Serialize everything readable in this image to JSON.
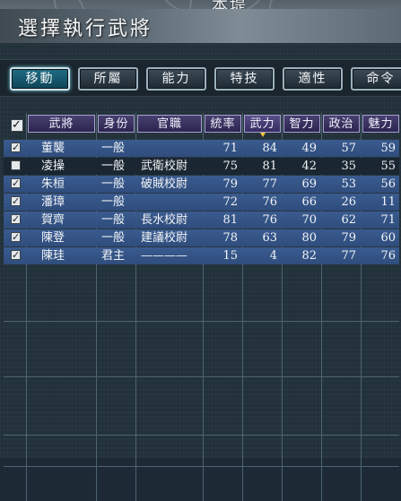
{
  "map": {
    "label": "本堤"
  },
  "title": "選擇執行武將",
  "tabs": [
    {
      "label": "移動",
      "active": true
    },
    {
      "label": "所屬",
      "active": false
    },
    {
      "label": "能力",
      "active": false
    },
    {
      "label": "特技",
      "active": false
    },
    {
      "label": "適性",
      "active": false
    },
    {
      "label": "命令",
      "active": false
    }
  ],
  "table": {
    "header_check": "✓",
    "columns": [
      "武將",
      "身份",
      "官職",
      "統率",
      "武力",
      "智力",
      "政治",
      "魅力"
    ],
    "sorted_column": "武力",
    "rows": [
      {
        "checked": true,
        "name": "董襲",
        "status": "一般",
        "office": "",
        "lead": "71",
        "war": "84",
        "int": "49",
        "pol": "57",
        "cha": "59"
      },
      {
        "checked": false,
        "name": "凌操",
        "status": "一般",
        "office": "武衛校尉",
        "lead": "75",
        "war": "81",
        "int": "42",
        "pol": "35",
        "cha": "55"
      },
      {
        "checked": true,
        "name": "朱桓",
        "status": "一般",
        "office": "破賊校尉",
        "lead": "79",
        "war": "77",
        "int": "69",
        "pol": "53",
        "cha": "56"
      },
      {
        "checked": true,
        "name": "潘璋",
        "status": "一般",
        "office": "",
        "lead": "72",
        "war": "76",
        "int": "66",
        "pol": "26",
        "cha": "11"
      },
      {
        "checked": true,
        "name": "賀齊",
        "status": "一般",
        "office": "長水校尉",
        "lead": "81",
        "war": "76",
        "int": "70",
        "pol": "62",
        "cha": "71"
      },
      {
        "checked": true,
        "name": "陳登",
        "status": "一般",
        "office": "建議校尉",
        "lead": "78",
        "war": "63",
        "int": "80",
        "pol": "79",
        "cha": "60"
      },
      {
        "checked": true,
        "name": "陳珪",
        "status": "君主",
        "office": "————",
        "lead": "15",
        "war": "4",
        "int": "82",
        "pol": "77",
        "cha": "76"
      }
    ]
  },
  "colors": {
    "selected_row": "#3a5b90",
    "header": "#484070",
    "active_tab": "#1f6c84",
    "sort_marker": "#f2c53d"
  }
}
